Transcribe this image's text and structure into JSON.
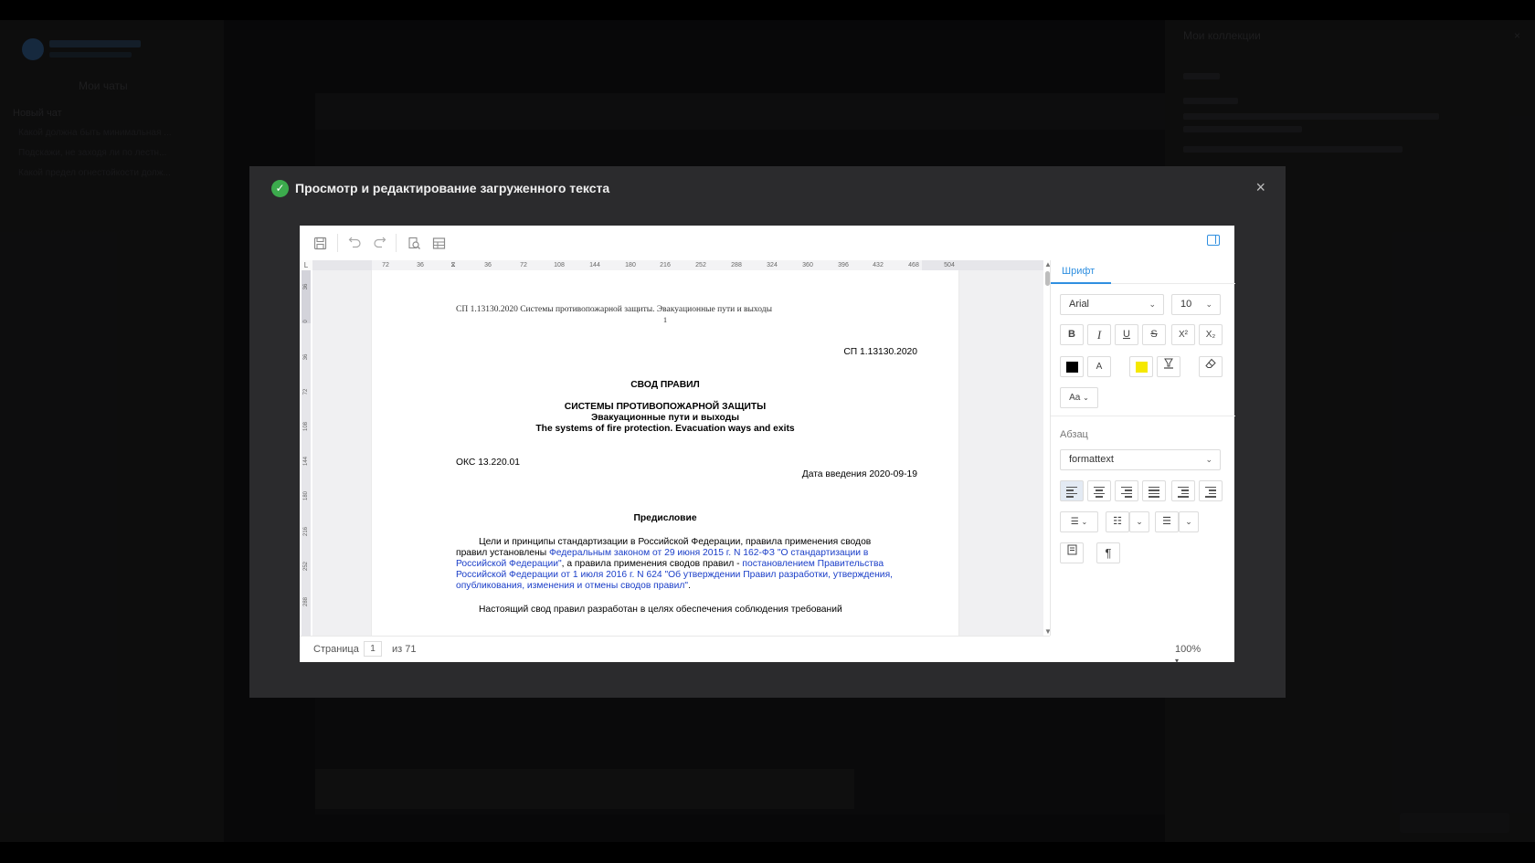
{
  "background_app": {
    "left_title": "Мои чаты",
    "new_chat": "Новый чат",
    "chats": [
      "Какой должна быть минимальная ...",
      "Подскажи, не заходя ли по лестн...",
      "Какой предел огнестойкости долж..."
    ],
    "right_title": "Мои коллекции"
  },
  "modal": {
    "title": "Просмотр и редактирование загруженного текста",
    "close": "×"
  },
  "toolbar": {
    "icons": [
      "save-icon",
      "undo-icon",
      "redo-icon",
      "find-replace-icon",
      "table-icon"
    ]
  },
  "ruler": {
    "corner": "L",
    "h_ticks": [
      "72",
      "36",
      "36",
      "72",
      "108",
      "144",
      "180",
      "216",
      "252",
      "288",
      "324",
      "360",
      "396",
      "432",
      "468",
      "504"
    ],
    "v_ticks": [
      "36",
      "0",
      "36",
      "72",
      "108",
      "144",
      "180",
      "216",
      "252",
      "288"
    ]
  },
  "document": {
    "header": "СП 1.13130.2020 Системы противопожарной защиты. Эвакуационные пути и выходы",
    "page_number": "1",
    "code": "СП 1.13130.2020",
    "heading1": "СВОД ПРАВИЛ",
    "heading2": "СИСТЕМЫ ПРОТИВОПОЖАРНОЙ ЗАЩИТЫ",
    "heading3": "Эвакуационные пути и выходы",
    "heading4": "The systems of fire protection. Evacuation ways and exits",
    "oks": "ОКС 13.220.01",
    "date": "Дата введения 2020-09-19",
    "foreword_title": "Предисловие",
    "p1_l1": "Цели и принципы стандартизации в Российской Федерации, правила применения сводов",
    "p1_l2_a": "правил установлены ",
    "p1_l2_b": "Федеральным законом от 29 июня 2015 г. N 162-ФЗ \"О стандартизации в",
    "p1_l3_a": "Российской Федерации\"",
    "p1_l3_b": ", а правила применения сводов правил - ",
    "p1_l3_c": "постановлением Правительства",
    "p1_l4": "Российской Федерации от 1 июля 2016 г. N 624 \"Об утверждении Правил разработки, утверждения,",
    "p1_l5_a": "опубликования, изменения и отмены сводов правил\"",
    "p1_l5_b": ".",
    "p2_l1": "Настоящий свод правил разработан в целях обеспечения соблюдения требований"
  },
  "status": {
    "page_label": "Страница",
    "page_value": "1",
    "of_label": "из 71",
    "zoom": "100%"
  },
  "sidebar": {
    "tab": "Шрифт",
    "font_family": "Arial",
    "font_size": "10",
    "format_buttons": [
      "B",
      "I",
      "U",
      "S",
      "X²",
      "X₂"
    ],
    "text_color": "#000000",
    "highlight_color": "#f5e800",
    "font_color_letter": "A",
    "case_button": "Aa",
    "paragraph_label": "Абзац",
    "paragraph_style": "formattext"
  }
}
